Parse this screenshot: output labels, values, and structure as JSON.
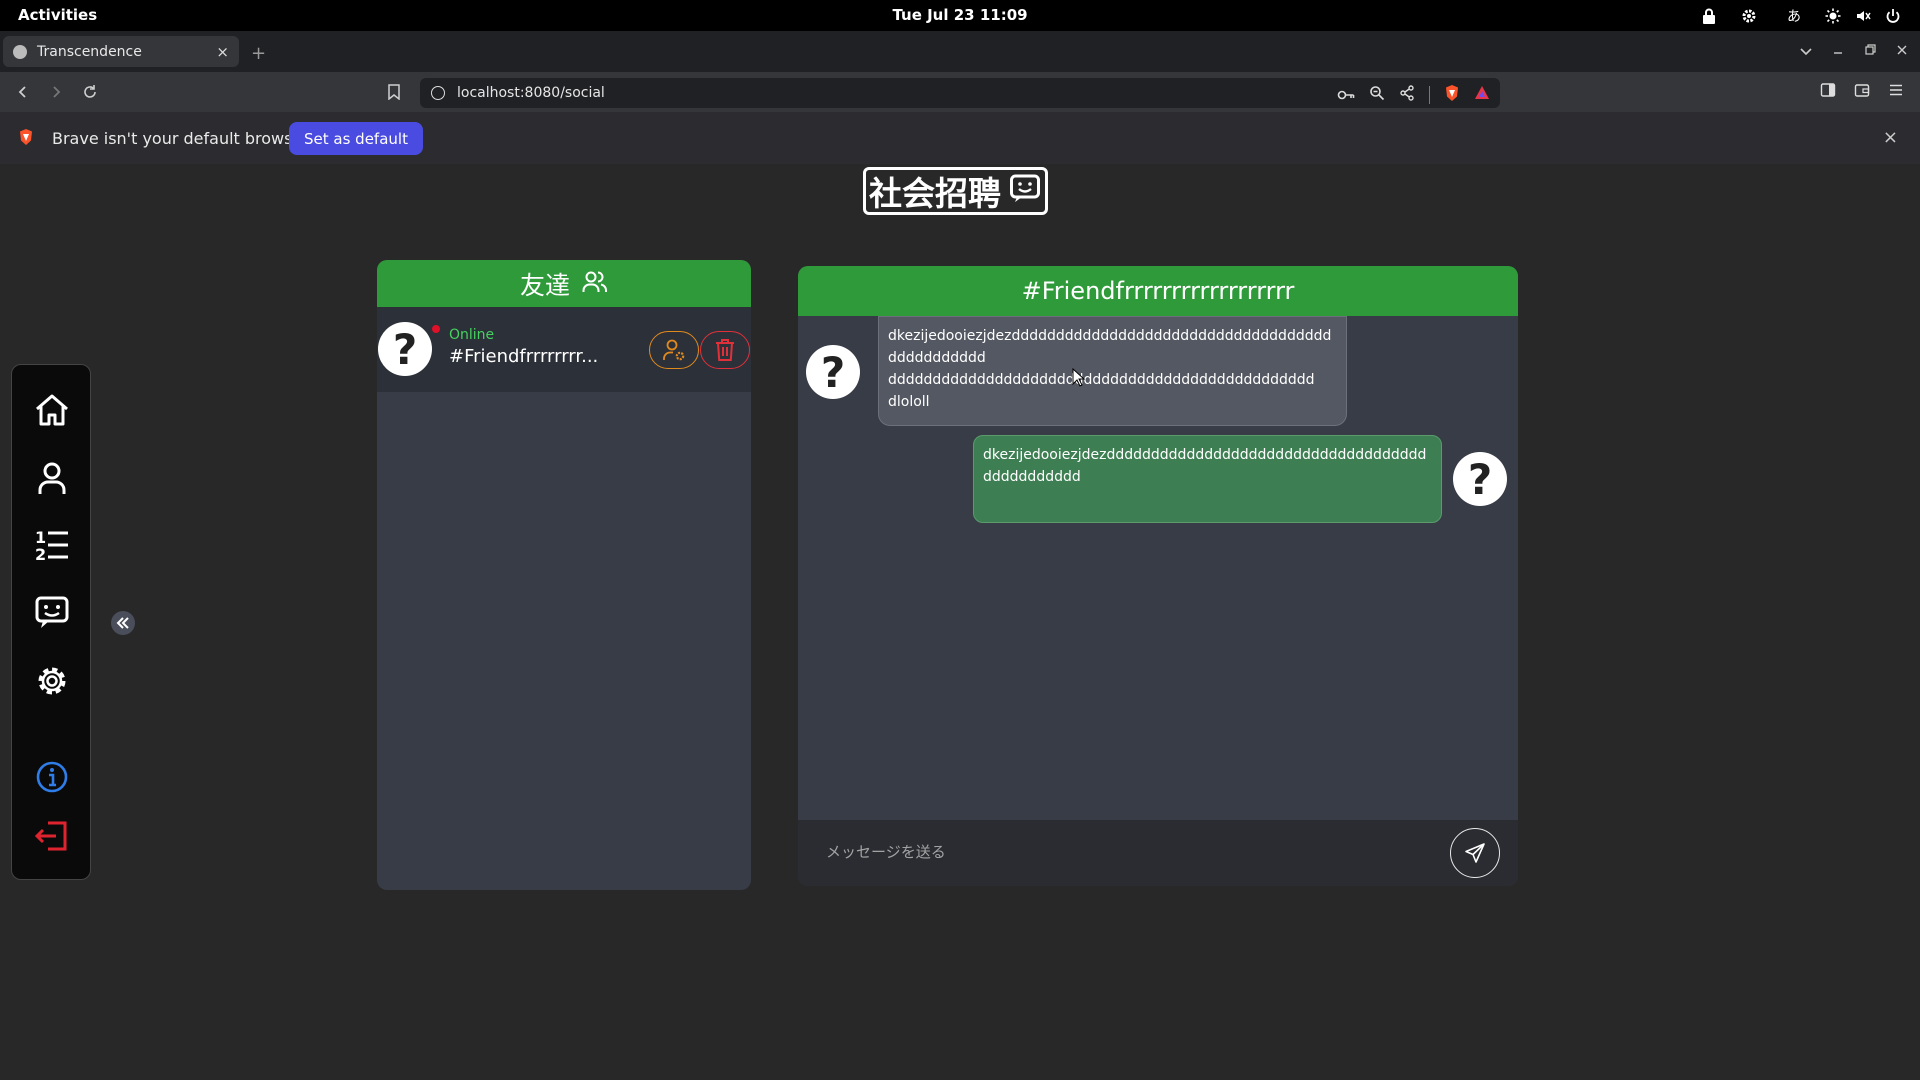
{
  "system": {
    "activities_label": "Activities",
    "clock": "Tue Jul 23  11:09",
    "tray_icons": [
      "lock-icon",
      "settings-icon",
      "input-method-icon",
      "brightness-icon",
      "volume-icon",
      "power-icon"
    ],
    "input_method": "あ"
  },
  "browser": {
    "tab": {
      "title": "Transcendence",
      "close": "×"
    },
    "new_tab": "+",
    "url": "localhost:8080/social",
    "infobar": {
      "message": "Brave isn't your default browser",
      "button": "Set as default",
      "close": "×"
    }
  },
  "page": {
    "title": "社会招聘",
    "sidebar": {
      "items": [
        "home-icon",
        "profile-icon",
        "leaderboard-icon",
        "chat-icon",
        "settings-icon",
        "info-icon",
        "logout-icon"
      ]
    },
    "friends_panel": {
      "header": "友達",
      "friends": [
        {
          "status": "Online",
          "name": "#Friendfrrrrrrrr...",
          "avatar": "?"
        }
      ]
    },
    "chat": {
      "header": "#Friendfrrrrrrrrrrrrrrrrrr",
      "messages": [
        {
          "direction": "incoming",
          "lines": [
            "dkezijedooiezjdezdddddddddddddddddddddddddddddddddddd",
            "ddddddddddd",
            "dddddddddddddddddddddddddddddddddddddddddddddddd",
            "dlololl"
          ],
          "avatar": "?"
        },
        {
          "direction": "outgoing",
          "lines": [
            "dkezijedooiezjdezdddddddddddddddddddddddddddddddddddd",
            "ddddddddddd"
          ],
          "avatar": "?"
        }
      ],
      "input_placeholder": "メッセージを送る"
    }
  },
  "colors": {
    "accent_green": "#2f9a3a",
    "online_green": "#46d160",
    "danger_red": "#e0303a",
    "invite_orange": "#e08a1e",
    "brave_button": "#4a4be0"
  }
}
